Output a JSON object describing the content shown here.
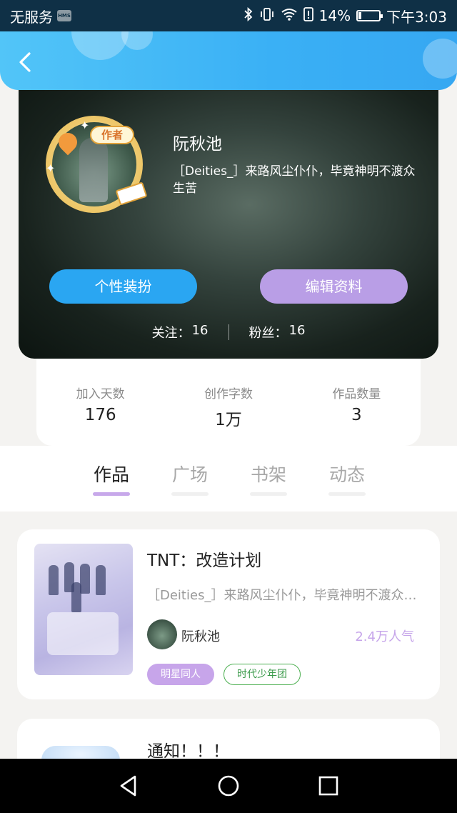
{
  "status_bar": {
    "carrier": "无服务",
    "hms": "HMS",
    "battery": "14%",
    "battery_level": 0.14,
    "time": "下午3:03"
  },
  "header": {
    "back_icon": "chevron-left-icon"
  },
  "profile": {
    "nickname": "阮秋池",
    "badge": "作者",
    "bio": "［Deities_］来路风尘仆仆，毕竟神明不渡众生苦",
    "outfit_button": "个性装扮",
    "edit_button": "编辑资料",
    "following_label": "关注：",
    "following_count": "16",
    "followers_label": "粉丝：",
    "followers_count": "16"
  },
  "stats": [
    {
      "label": "加入天数",
      "value": "176"
    },
    {
      "label": "创作字数",
      "value": "1万"
    },
    {
      "label": "作品数量",
      "value": "3"
    }
  ],
  "tabs": [
    {
      "label": "作品",
      "active": true
    },
    {
      "label": "广场",
      "active": false
    },
    {
      "label": "书架",
      "active": false
    },
    {
      "label": "动态",
      "active": false
    }
  ],
  "works": [
    {
      "title": "TNT：改造计划",
      "description": "［Deities_］来路风尘仆仆，毕竟神明不渡众生苦",
      "author": "阮秋池",
      "popularity": "2.4万人气",
      "tags": [
        "明星同人",
        "时代少年团"
      ]
    },
    {
      "title": "通知！！！"
    }
  ],
  "colors": {
    "header_blue": "#3ab0f5",
    "outfit_button": "#2aa6f2",
    "edit_button": "#b99ee6",
    "active_tab_underline": "#c7a8ea",
    "popularity": "#c6a5ea",
    "tag_outline": "#4caf50"
  },
  "nav_bar": {
    "back": "triangle-back-icon",
    "home": "circle-home-icon",
    "recents": "square-recents-icon"
  }
}
